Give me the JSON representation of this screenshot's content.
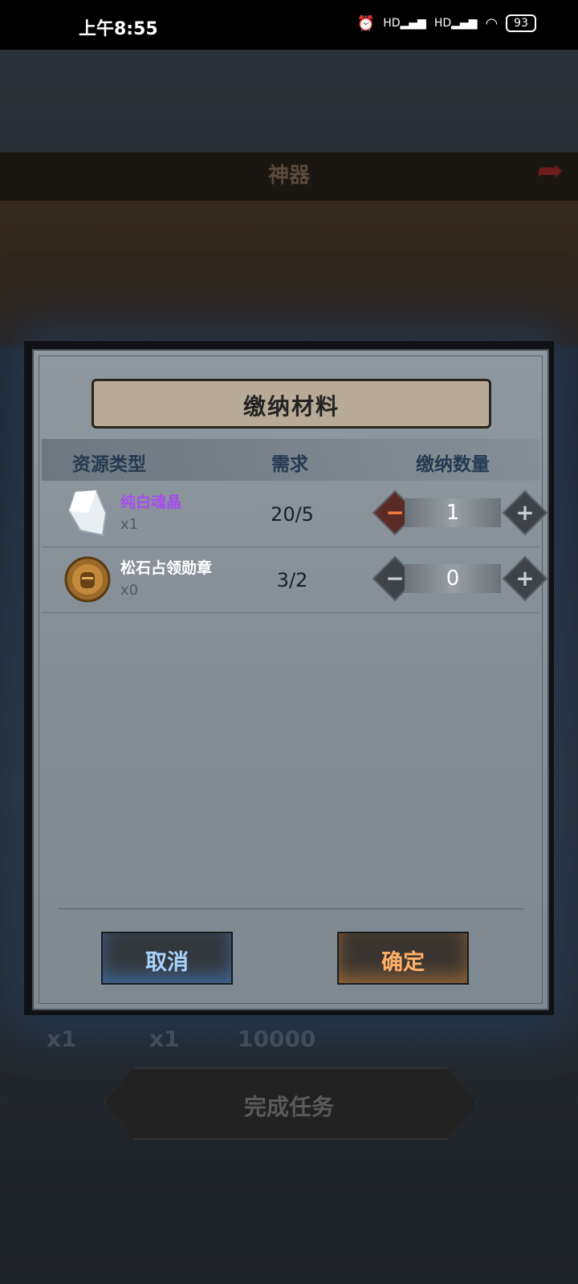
{
  "status_bar": {
    "time": "上午8:55",
    "battery": "93",
    "signal1": "HD",
    "signal2": "HD"
  },
  "background": {
    "title": "神器",
    "rewards": [
      "x1",
      "x1",
      "10000"
    ],
    "complete_button": "完成任务"
  },
  "dialog": {
    "title": "缴纳材料",
    "headers": {
      "type": "资源类型",
      "need": "需求",
      "amount": "缴纳数量"
    },
    "items": [
      {
        "name": "纯白魂晶",
        "count": "x1",
        "need": "20/5",
        "quantity": "1",
        "name_color": "#a64cf0",
        "icon": "white-crystal-icon"
      },
      {
        "name": "松石占领勋章",
        "count": "x0",
        "need": "3/2",
        "quantity": "0",
        "name_color": "#ffffff",
        "icon": "knight-medal-icon"
      }
    ],
    "cancel_label": "取消",
    "confirm_label": "确定"
  },
  "colors": {
    "cancel_text": "#a9d4ff",
    "confirm_text": "#ffb067"
  }
}
